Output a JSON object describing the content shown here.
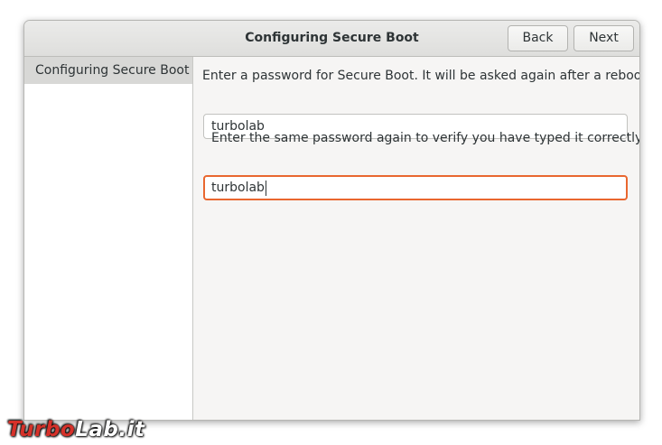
{
  "window": {
    "title": "Configuring Secure Boot",
    "back_label": "Back",
    "next_label": "Next"
  },
  "sidebar": {
    "items": [
      {
        "label": "Configuring Secure Boot",
        "selected": true
      }
    ]
  },
  "form": {
    "prompt_label": "Enter a password for Secure Boot. It will be asked again after a reboot.",
    "password_value": "turbolab",
    "confirm_label": "Enter the same password again to verify you have typed it correctly.",
    "confirm_value": "turbolab"
  },
  "watermark": {
    "part1": "Turbo",
    "part2": "Lab.it"
  },
  "colors": {
    "focus_border": "#e9672f",
    "sidebar_selected": "#d8d8d6",
    "watermark_red": "#d6312a"
  }
}
